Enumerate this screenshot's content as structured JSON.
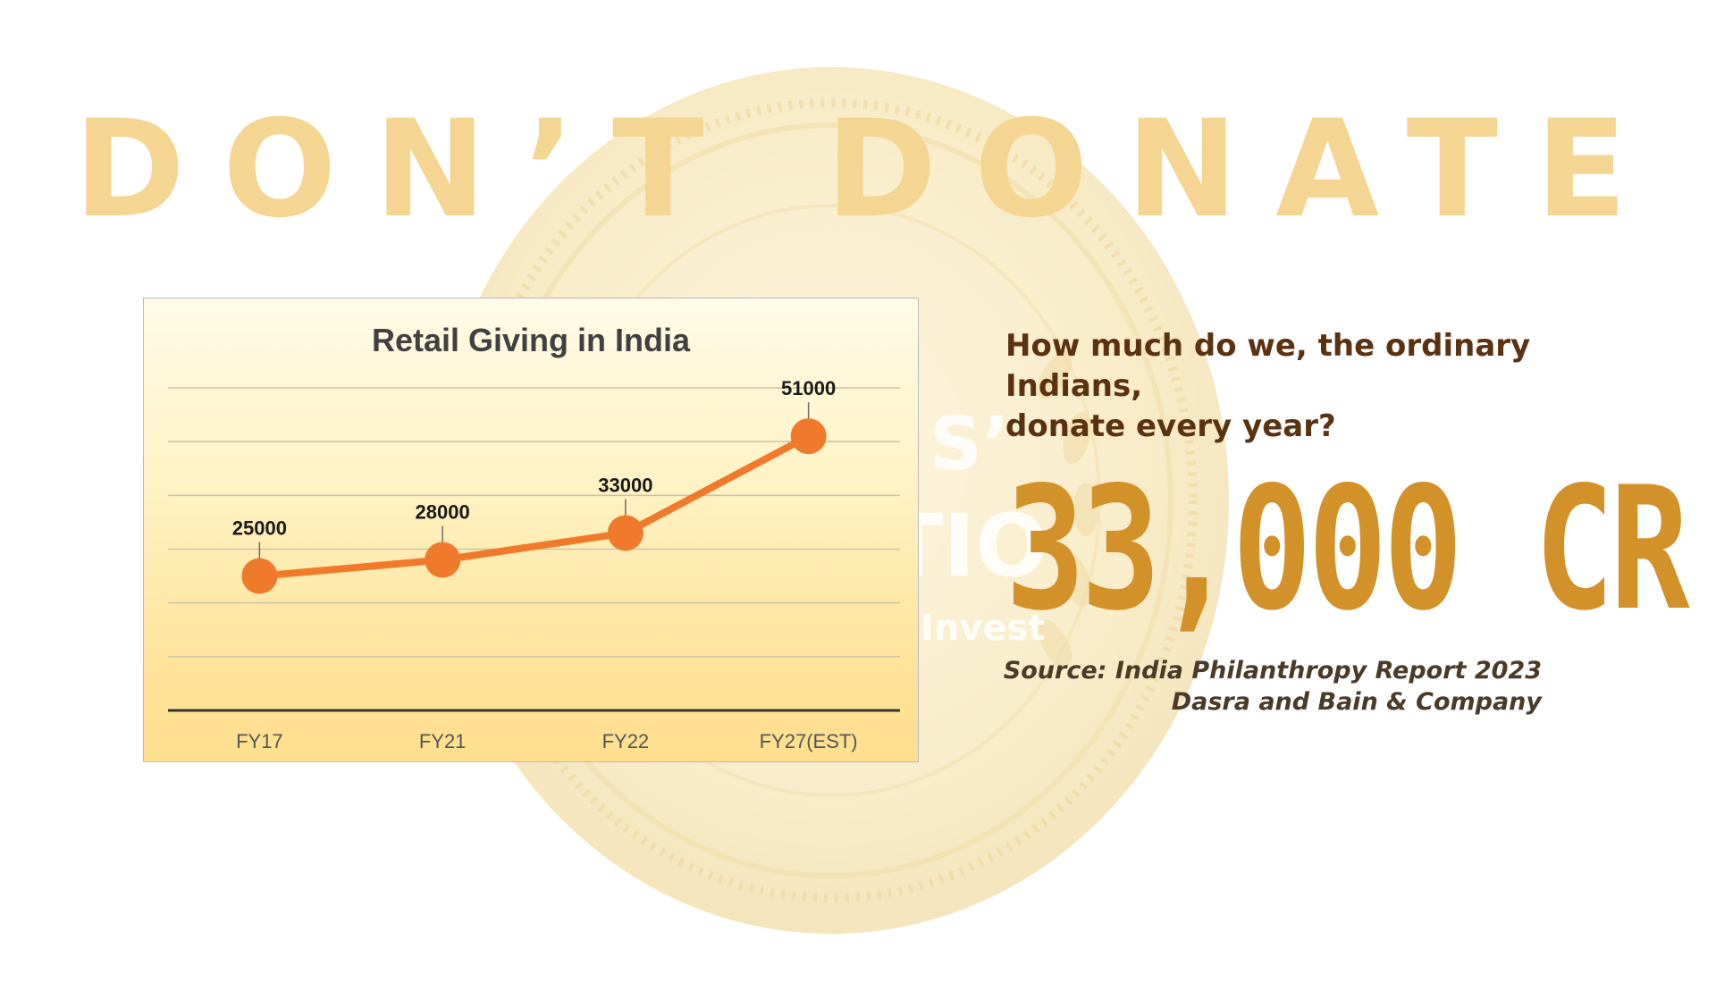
{
  "headline": "DON’T DONATE",
  "background": {
    "coin_text_top": "S’",
    "coin_text_mid": "TIO",
    "coin_text_low": "Invest"
  },
  "chart_data": {
    "type": "line",
    "title": "Retail Giving in India",
    "categories": [
      "FY17",
      "FY21",
      "FY22",
      "FY27(EST)"
    ],
    "values": [
      25000,
      28000,
      33000,
      51000
    ],
    "data_labels": [
      "25000",
      "28000",
      "33000",
      "51000"
    ],
    "xlabel": "",
    "ylabel": "",
    "ylim": [
      0,
      60000
    ],
    "gridlines": true,
    "legend": "none",
    "line_color": "#f07a2a",
    "marker_color": "#ef7a2b"
  },
  "question": {
    "line1": "How much do we, the ordinary",
    "line2": "Indians,",
    "line3": "donate every year?"
  },
  "big_number": "33,000 CR",
  "source": {
    "line1": "Source: India Philanthropy Report 2023",
    "line2": "Dasra and Bain & Company"
  },
  "colors": {
    "headline": "#f4d592",
    "big_number": "#d3912a",
    "question": "#5a3211",
    "source": "#4a3a28"
  }
}
